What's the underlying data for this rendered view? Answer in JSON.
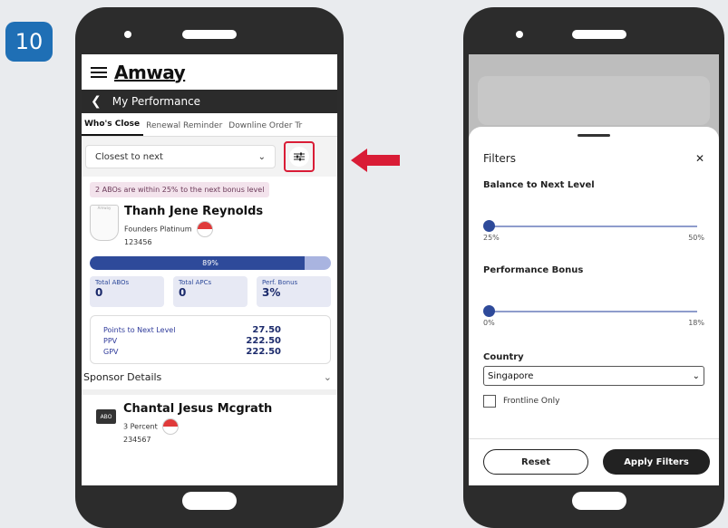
{
  "step_number": "10",
  "left_phone": {
    "app_logo": "Amway",
    "nav_title": "My Performance",
    "tabs": [
      {
        "label": "Who's Close",
        "active": true
      },
      {
        "label": "Renewal Reminder",
        "active": false
      },
      {
        "label": "Downline Order Tr",
        "active": false
      }
    ],
    "sort_select": {
      "value": "Closest to next"
    },
    "info_pill": "2 ABOs are within 25% to the next bonus level",
    "person": {
      "name": "Thanh Jene Reynolds",
      "level": "Founders Platinum",
      "id": "123456"
    },
    "progress": {
      "label": "89%",
      "value": 0.89
    },
    "stats": [
      {
        "label": "Total ABOs",
        "value": "0"
      },
      {
        "label": "Total APCs",
        "value": "0"
      },
      {
        "label": "Perf. Bonus",
        "value": "3%"
      }
    ],
    "points": [
      {
        "label": "Points to Next Level",
        "value": "27.50"
      },
      {
        "label": "PPV",
        "value": "222.50"
      },
      {
        "label": "GPV",
        "value": "222.50"
      }
    ],
    "sponsor_label": "Sponsor Details",
    "person2": {
      "badge": "ABO",
      "name": "Chantal Jesus Mcgrath",
      "level": "3 Percent",
      "id": "234567"
    }
  },
  "right_phone": {
    "sheet_title": "Filters",
    "close_glyph": "✕",
    "balance": {
      "title": "Balance to Next Level",
      "min_label": "25%",
      "max_label": "50%",
      "value": 0
    },
    "bonus": {
      "title": "Performance Bonus",
      "min_label": "0%",
      "max_label": "18%",
      "value": 0
    },
    "country": {
      "label": "Country",
      "value": "Singapore"
    },
    "frontline": {
      "label": "Frontline Only",
      "checked": false
    },
    "reset_label": "Reset",
    "apply_label": "Apply Filters"
  },
  "colors": {
    "highlight": "#d91c36",
    "primary": "#2e4a9a",
    "step_badge": "#1f6fb5"
  }
}
